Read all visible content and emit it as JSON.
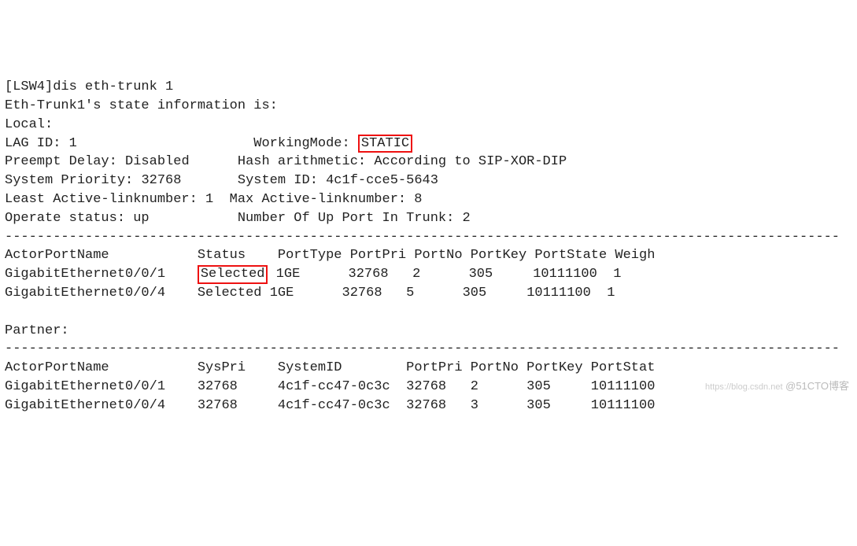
{
  "cmd": {
    "prompt": "[LSW4]",
    "command": "dis eth-trunk 1"
  },
  "header": {
    "title": "Eth-Trunk1's state information is:",
    "localLabel": "Local:"
  },
  "props": {
    "lagIdLabel": "LAG ID:",
    "lagId": "1",
    "workingModeLabel": "WorkingMode:",
    "workingMode": "STATIC",
    "preemptDelayLabel": "Preempt Delay:",
    "preemptDelay": "Disabled",
    "hashLabel": "Hash arithmetic:",
    "hash": "According to SIP-XOR-DIP",
    "sysPriLabel": "System Priority:",
    "sysPri": "32768",
    "sysIdLabel": "System ID:",
    "sysId": "4c1f-cce5-5643",
    "leastActiveLabel": "Least Active-linknumber:",
    "leastActive": "1",
    "maxActiveLabel": "Max Active-linknumber:",
    "maxActive": "8",
    "operStatusLabel": "Operate status:",
    "operStatus": "up",
    "numUpLabel": "Number Of Up Port In Trunk:",
    "numUp": "2"
  },
  "dashes": "--------------------------------------------------------------------------------------------------------",
  "localHeaders": {
    "c0": "ActorPortName",
    "c1": "Status",
    "c2": "PortType",
    "c3": "PortPri",
    "c4": "PortNo",
    "c5": "PortKey",
    "c6": "PortState",
    "c7": "Weigh"
  },
  "localRows": [
    {
      "c0": "GigabitEthernet0/0/1",
      "c1": "Selected",
      "c2": "1GE",
      "c3": "32768",
      "c4": "2",
      "c5": "305",
      "c6": "10111100",
      "c7": "1"
    },
    {
      "c0": "GigabitEthernet0/0/4",
      "c1": "Selected",
      "c2": "1GE",
      "c3": "32768",
      "c4": "5",
      "c5": "305",
      "c6": "10111100",
      "c7": "1"
    }
  ],
  "partnerLabel": "Partner:",
  "partnerHeaders": {
    "c0": "ActorPortName",
    "c1": "SysPri",
    "c2": "SystemID",
    "c3": "PortPri",
    "c4": "PortNo",
    "c5": "PortKey",
    "c6": "PortStat"
  },
  "partnerRows": [
    {
      "c0": "GigabitEthernet0/0/1",
      "c1": "32768",
      "c2": "4c1f-cc47-0c3c",
      "c3": "32768",
      "c4": "2",
      "c5": "305",
      "c6": "10111100"
    },
    {
      "c0": "GigabitEthernet0/0/4",
      "c1": "32768",
      "c2": "4c1f-cc47-0c3c",
      "c3": "32768",
      "c4": "3",
      "c5": "305",
      "c6": "10111100"
    }
  ],
  "watermark": {
    "small": "https://blog.csdn.net",
    "main": "@51CTO博客"
  }
}
